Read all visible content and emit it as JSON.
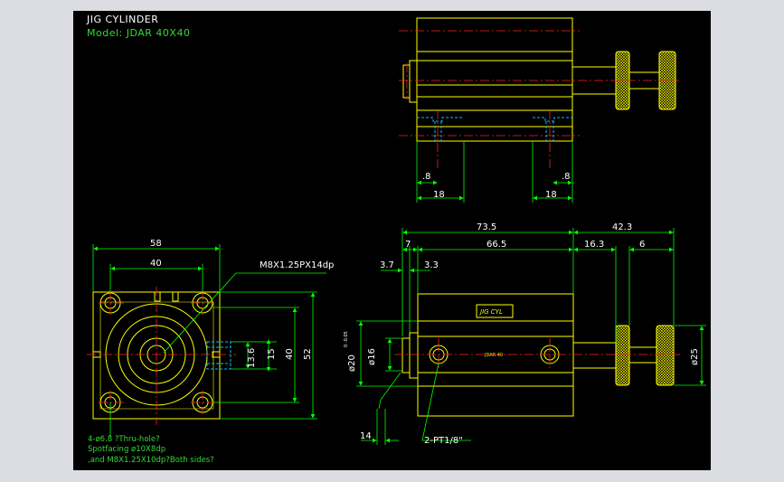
{
  "header": {
    "title": "JIG CYLINDER",
    "model": "Model:  JDAR  40X40"
  },
  "colors": {
    "outline": "#ffff00",
    "center": "#ff2020",
    "dim": "#00ff00",
    "hidden": "#00bfff",
    "text": "#ffffff"
  },
  "top_view": {
    "dims": {
      "port_left_small": ".8",
      "port_left": "18",
      "port_right_small": ".8",
      "port_right": "18"
    }
  },
  "front_view": {
    "dims": {
      "width_outer": "58",
      "width_inner": "40",
      "thread_label": "M8X1.25PX14dp",
      "h_13_6": "13.6",
      "h_15": "15",
      "h_40": "40",
      "h_52": "52"
    },
    "notes": [
      "4-ø6.8 ?Thru-hole?",
      " Spotfacing ø10X8dp",
      ",and M8X1.25X10dp?Both sides?"
    ]
  },
  "side_view": {
    "dims": {
      "total": "73.5",
      "ext": "42.3",
      "d7": "7",
      "body": "66.5",
      "d16_3": "16.3",
      "d6": "6",
      "d3_7": "3.7",
      "d3_3": "3.3",
      "rod_dia": "ø16",
      "bore_dia": "ø20",
      "bore_tol": "0\n-0.05",
      "knob_dia": "ø25",
      "d14": "14",
      "port_label": "2-PT1/8\""
    },
    "plate_text": "JIG CYL",
    "small_text": "JDAR 40"
  }
}
